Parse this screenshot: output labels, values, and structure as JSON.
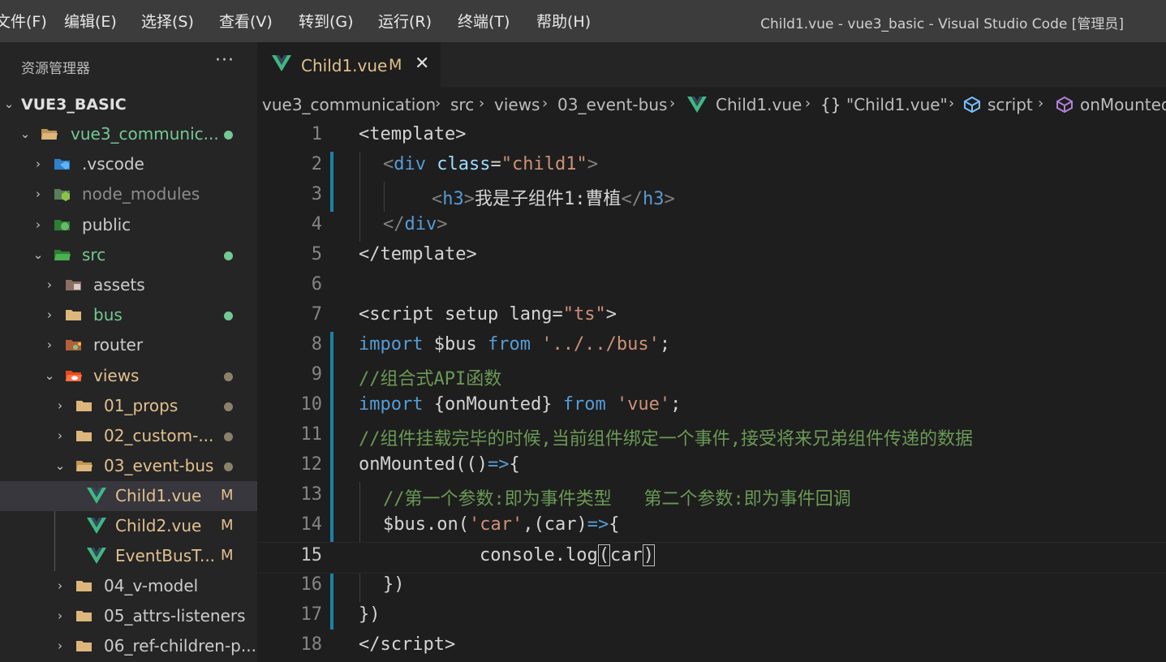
{
  "menu": [
    "文件(F)",
    "编辑(E)",
    "选择(S)",
    "查看(V)",
    "转到(G)",
    "运行(R)",
    "终端(T)",
    "帮助(H)"
  ],
  "window_title": "Child1.vue - vue3_basic - Visual Studio Code [管理员]",
  "explorer": {
    "header": "资源管理器",
    "more": "···",
    "root": "VUE3_BASIC",
    "items": [
      {
        "label": "vue3_communic...",
        "badge": ""
      },
      {
        "label": ".vscode",
        "badge": ""
      },
      {
        "label": "node_modules",
        "badge": ""
      },
      {
        "label": "public",
        "badge": ""
      },
      {
        "label": "src",
        "badge": ""
      },
      {
        "label": "assets",
        "badge": ""
      },
      {
        "label": "bus",
        "badge": ""
      },
      {
        "label": "router",
        "badge": ""
      },
      {
        "label": "views",
        "badge": ""
      },
      {
        "label": "01_props",
        "badge": ""
      },
      {
        "label": "02_custom-...",
        "badge": ""
      },
      {
        "label": "03_event-bus",
        "badge": ""
      },
      {
        "label": "Child1.vue",
        "badge": "M"
      },
      {
        "label": "Child2.vue",
        "badge": "M"
      },
      {
        "label": "EventBusT...",
        "badge": "M"
      },
      {
        "label": "04_v-model",
        "badge": ""
      },
      {
        "label": "05_attrs-listeners",
        "badge": ""
      },
      {
        "label": "06_ref-children-p...",
        "badge": ""
      }
    ]
  },
  "tab": {
    "label": "Child1.vue",
    "status": "M",
    "close": "✕"
  },
  "breadcrumb": [
    "vue3_communication",
    "src",
    "views",
    "03_event-bus",
    "Child1.vue",
    "\"Child1.vue\"",
    "script",
    "onMounted"
  ],
  "breadcrumb_braces": "{}",
  "code": {
    "line_numbers": [
      "1",
      "2",
      "3",
      "4",
      "5",
      "6",
      "7",
      "8",
      "9",
      "10",
      "11",
      "12",
      "13",
      "14",
      "15",
      "16",
      "17",
      "18"
    ],
    "l1": [
      "<",
      "template",
      ">"
    ],
    "l2": [
      "<",
      "div",
      " class",
      "=",
      "\"child1\"",
      ">"
    ],
    "l3": [
      "<",
      "h3",
      ">",
      "我是子组件1:曹植",
      "</",
      "h3",
      ">"
    ],
    "l4": [
      "</",
      "div",
      ">"
    ],
    "l5": [
      "</",
      "template",
      ">"
    ],
    "l7": [
      "<",
      "script",
      " setup",
      " lang",
      "=",
      "\"ts\"",
      ">"
    ],
    "l8": [
      "import",
      " $bus ",
      "from",
      " ",
      "'../../bus'",
      ";"
    ],
    "l9": "//组合式API函数",
    "l10": [
      "import",
      " {",
      "onMounted",
      "} ",
      "from",
      " ",
      "'vue'",
      ";"
    ],
    "l11": "//组件挂载完毕的时候,当前组件绑定一个事件,接受将来兄弟组件传递的数据",
    "l12": [
      "onMounted",
      "((",
      ")",
      "=>",
      "{"
    ],
    "l13": "//第一个参数:即为事件类型   第二个参数:即为事件回调",
    "l14": [
      "$bus",
      ".",
      "on",
      "(",
      "'car'",
      ",(",
      "car",
      ")",
      "=>",
      "{"
    ],
    "l15": [
      "console",
      ".",
      "log",
      "(",
      "car",
      ")"
    ],
    "l16": "})",
    "l17": "})",
    "l18": [
      "</",
      "script",
      ">"
    ]
  },
  "colors": {
    "accent": "#1b81a8",
    "modified": "#e2c08d",
    "untracked": "#73c991",
    "vue": "#41b883"
  }
}
